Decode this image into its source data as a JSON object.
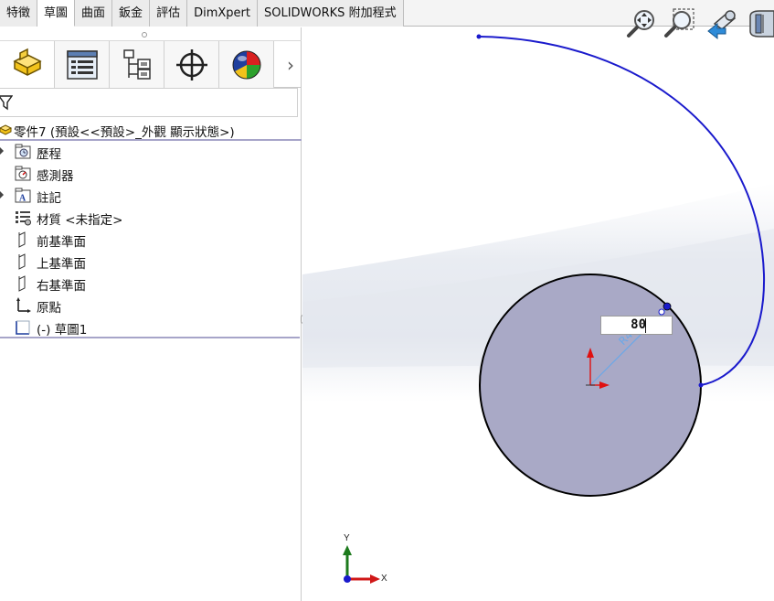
{
  "tabs": [
    {
      "label": "特徵",
      "active": false
    },
    {
      "label": "草圖",
      "active": true
    },
    {
      "label": "曲面",
      "active": false
    },
    {
      "label": "鈑金",
      "active": false
    },
    {
      "label": "評估",
      "active": false
    },
    {
      "label": "DimXpert",
      "active": false
    },
    {
      "label": "SOLIDWORKS 附加程式",
      "active": false
    }
  ],
  "manager_tabs": [
    {
      "icon": "feature-manager-icon"
    },
    {
      "icon": "property-manager-icon"
    },
    {
      "icon": "configuration-manager-icon"
    },
    {
      "icon": "dimxpert-manager-icon"
    },
    {
      "icon": "display-manager-icon"
    }
  ],
  "tree": {
    "root_label": "零件7  (預設<<預設>_外觀 顯示狀態>)",
    "items": [
      {
        "label": "歷程",
        "icon": "history-folder-icon",
        "expandable": true
      },
      {
        "label": "感測器",
        "icon": "sensors-folder-icon",
        "expandable": false
      },
      {
        "label": "註記",
        "icon": "annotations-folder-icon",
        "expandable": true
      },
      {
        "label": "材質 <未指定>",
        "icon": "material-icon",
        "expandable": false
      },
      {
        "label": "前基準面",
        "icon": "front-plane-icon",
        "expandable": false
      },
      {
        "label": "上基準面",
        "icon": "top-plane-icon",
        "expandable": false
      },
      {
        "label": "右基準面",
        "icon": "right-plane-icon",
        "expandable": false
      },
      {
        "label": "原點",
        "icon": "origin-icon",
        "expandable": false
      },
      {
        "label": "(-) 草圖1",
        "icon": "sketch-icon",
        "expandable": false
      }
    ]
  },
  "hud_tools": [
    "zoom-to-fit-icon",
    "zoom-to-area-icon",
    "previous-view-icon",
    "section-view-icon"
  ],
  "dimension": {
    "value": "80"
  },
  "triad": {
    "x_label": "X",
    "y_label": "Y"
  },
  "colors": {
    "sketch_line": "#1a1acc",
    "circle_fill": "#a9a9c6",
    "origin_x": "#e01010",
    "origin_y": "#e01010",
    "dimension_ghost": "#6aa8e8"
  }
}
